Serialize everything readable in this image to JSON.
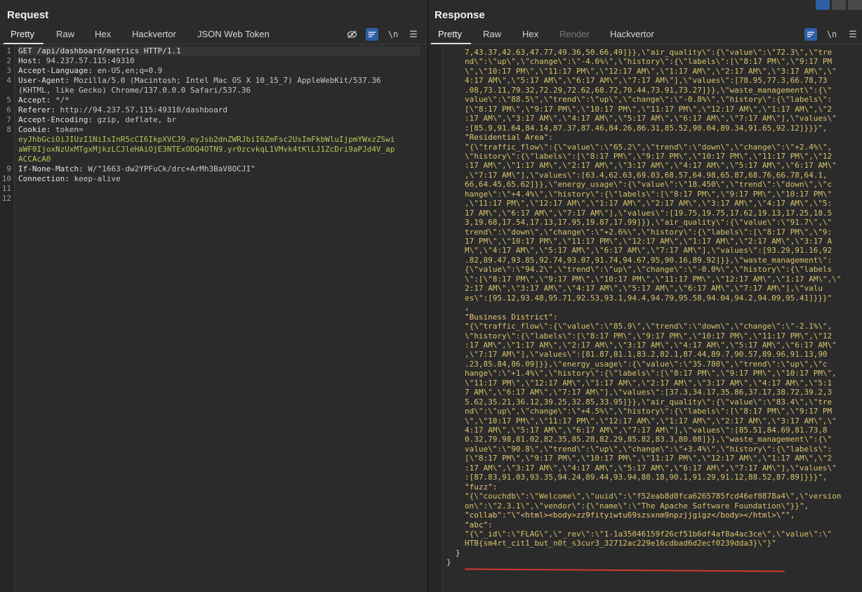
{
  "request": {
    "title": "Request",
    "tabs": [
      "Pretty",
      "Raw",
      "Hex",
      "Hackvertor",
      "JSON Web Token"
    ],
    "lines": [
      {
        "n": "1",
        "key": "GET /api/dashboard/metrics HTTP/1.1",
        "val": ""
      },
      {
        "n": "2",
        "key": "Host: ",
        "val": "94.237.57.115:49310"
      },
      {
        "n": "3",
        "key": "Accept-Language: ",
        "val": "en-US,en;q=0.9"
      },
      {
        "n": "4",
        "key": "User-Agent: ",
        "val": "Mozilla/5.0 (Macintosh; Intel Mac OS X 10_15_7) AppleWebKit/537.36"
      },
      {
        "n": "",
        "key": "",
        "val": "(KHTML, like Gecko) Chrome/137.0.0.0 Safari/537.36"
      },
      {
        "n": "5",
        "key": "Accept: ",
        "val": "*/*"
      },
      {
        "n": "6",
        "key": "Referer: ",
        "val": "http://94.237.57.115:49310/dashboard"
      },
      {
        "n": "7",
        "key": "Accept-Encoding: ",
        "val": "gzip, deflate, br"
      },
      {
        "n": "8",
        "key": "Cookie: ",
        "val": "token="
      },
      {
        "n": "",
        "key": "",
        "tok": "eyJhbGciOiJIUzI1NiIsInR5cCI6IkpXVCJ9.eyJsb2dnZWRJbiI6ZmFsc2UsImFkbWluIjpmYWxzZSwi"
      },
      {
        "n": "",
        "key": "",
        "tok": "aWF0IjoxNzUxMTgxMjkzLCJleHAiOjE3NTExODQ4OTN9.yr0zcvkqL1VMvk4tKlLJ1ZcDri9aPJd4V_ap"
      },
      {
        "n": "",
        "key": "",
        "tok": "ACCAcA0"
      },
      {
        "n": "9",
        "key": "If-None-Match: ",
        "val": "W/\"1663-dw2YPFuCk/drc+ArMh3BaV8OCJI\""
      },
      {
        "n": "10",
        "key": "Connection: ",
        "val": "keep-alive"
      },
      {
        "n": "11",
        "key": "",
        "val": ""
      },
      {
        "n": "12",
        "key": "",
        "val": ""
      }
    ]
  },
  "response": {
    "title": "Response",
    "tabs": [
      "Pretty",
      "Raw",
      "Hex",
      "Render",
      "Hackvertor"
    ],
    "lines": [
      {
        "t": "str",
        "text": "7,43.37,42.63,47.77,49.36,50.66,49]}},\\\"air_quality\\\":{\\\"value\\\":\\\"72.3\\\",\\\"tre"
      },
      {
        "t": "str",
        "text": "nd\\\":\\\"up\\\",\\\"change\\\":\\\"-4.6%\\\",\\\"history\\\":{\\\"labels\\\":[\\\"8:17 PM\\\",\\\"9:17 PM"
      },
      {
        "t": "str",
        "text": "\\\",\\\"10:17 PM\\\",\\\"11:17 PM\\\",\\\"12:17 AM\\\",\\\"1:17 AM\\\",\\\"2:17 AM\\\",\\\"3:17 AM\\\",\\\""
      },
      {
        "t": "str",
        "text": "4:17 AM\\\",\\\"5:17 AM\\\",\\\"6:17 AM\\\",\\\"7:17 AM\\\"],\\\"values\\\":[78.95,77.3,66.78,73"
      },
      {
        "t": "str",
        "text": ".08,73.11,79.32,72.29,72.62,68.72,70.44,73.91,73.27]}},\\\"waste_management\\\":{\\\""
      },
      {
        "t": "str",
        "text": "value\\\":\\\"88.5\\\",\\\"trend\\\":\\\"up\\\",\\\"change\\\":\\\"-0.8%\\\",\\\"history\\\":{\\\"labels\\\":"
      },
      {
        "t": "str",
        "text": "[\\\"8:17 PM\\\",\\\"9:17 PM\\\",\\\"10:17 PM\\\",\\\"11:17 PM\\\",\\\"12:17 AM\\\",\\\"1:17 AM\\\",\\\"2"
      },
      {
        "t": "str",
        "text": ":17 AM\\\",\\\"3:17 AM\\\",\\\"4:17 AM\\\",\\\"5:17 AM\\\",\\\"6:17 AM\\\",\\\"7:17 AM\\\"],\\\"values\\\""
      },
      {
        "t": "str",
        "text": ":[85.9,91.64,84.14,87.37,87.46,84.26,86.31,85.52,90.04,89.34,91.65,92.12]}}}\","
      },
      {
        "t": "key",
        "text": "\"Residential Area\":"
      },
      {
        "t": "str",
        "text": "\"{\\\"traffic_flow\\\":{\\\"value\\\":\\\"65.2\\\",\\\"trend\\\":\\\"down\\\",\\\"change\\\":\\\"+2.4%\\\","
      },
      {
        "t": "str",
        "text": "\\\"history\\\":{\\\"labels\\\":[\\\"8:17 PM\\\",\\\"9:17 PM\\\",\\\"10:17 PM\\\",\\\"11:17 PM\\\",\\\"12"
      },
      {
        "t": "str",
        "text": ":17 AM\\\",\\\"1:17 AM\\\",\\\"2:17 AM\\\",\\\"3:17 AM\\\",\\\"4:17 AM\\\",\\\"5:17 AM\\\",\\\"6:17 AM\\\""
      },
      {
        "t": "str",
        "text": ",\\\"7:17 AM\\\"],\\\"values\\\":[63.4,62.63,69.03,68.57,64.98,65.87,68.76,66.78,64.1,"
      },
      {
        "t": "str",
        "text": "66,64.45,65.62]}},\\\"energy_usage\\\":{\\\"value\\\":\\\"18.450\\\",\\\"trend\\\":\\\"down\\\",\\\"c"
      },
      {
        "t": "str",
        "text": "hange\\\":\\\"+4.4%\\\",\\\"history\\\":{\\\"labels\\\":[\\\"8:17 PM\\\",\\\"9:17 PM\\\",\\\"10:17 PM\\\""
      },
      {
        "t": "str",
        "text": ",\\\"11:17 PM\\\",\\\"12:17 AM\\\",\\\"1:17 AM\\\",\\\"2:17 AM\\\",\\\"3:17 AM\\\",\\\"4:17 AM\\\",\\\"5:"
      },
      {
        "t": "str",
        "text": "17 AM\\\",\\\"6:17 AM\\\",\\\"7:17 AM\\\"],\\\"values\\\":[19.75,19.75,17.62,19.13,17.25,18.5"
      },
      {
        "t": "str",
        "text": "3,19.68,17.54,17.13,17.95,19.87,17.99]}},\\\"air_quality\\\":{\\\"value\\\":\\\"91.7\\\",\\\""
      },
      {
        "t": "str",
        "text": "trend\\\":\\\"down\\\",\\\"change\\\":\\\"+2.6%\\\",\\\"history\\\":{\\\"labels\\\":[\\\"8:17 PM\\\",\\\"9:"
      },
      {
        "t": "str",
        "text": "17 PM\\\",\\\"10:17 PM\\\",\\\"11:17 PM\\\",\\\"12:17 AM\\\",\\\"1:17 AM\\\",\\\"2:17 AM\\\",\\\"3:17 A"
      },
      {
        "t": "str",
        "text": "M\\\",\\\"4:17 AM\\\",\\\"5:17 AM\\\",\\\"6:17 AM\\\",\\\"7:17 AM\\\"],\\\"values\\\":[93.29,91.16,92"
      },
      {
        "t": "str",
        "text": ".82,89.47,93.85,92.74,93.07,91.74,94.67,95,90.16,89.92]}},\\\"waste_management\\\":"
      },
      {
        "t": "str",
        "text": "{\\\"value\\\":\\\"94.2\\\",\\\"trend\\\":\\\"up\\\",\\\"change\\\":\\\"-0.0%\\\",\\\"history\\\":{\\\"labels"
      },
      {
        "t": "str",
        "text": "\\\":[\\\"8:17 PM\\\",\\\"9:17 PM\\\",\\\"10:17 PM\\\",\\\"11:17 PM\\\",\\\"12:17 AM\\\",\\\"1:17 AM\\\",\\\""
      },
      {
        "t": "str",
        "text": "2:17 AM\\\",\\\"3:17 AM\\\",\\\"4:17 AM\\\",\\\"5:17 AM\\\",\\\"6:17 AM\\\",\\\"7:17 AM\\\"],\\\"valu"
      },
      {
        "t": "str",
        "text": "es\\\":[95.12,93.48,95.71,92.53,93.1,94.4,94.79,95.58,94.04,94.2,94.09,95.41]}}}\""
      },
      {
        "t": "brace",
        "text": ","
      },
      {
        "t": "key",
        "text": "\"Business District\":"
      },
      {
        "t": "str",
        "text": "\"{\\\"traffic_flow\\\":{\\\"value\\\":\\\"85.9\\\",\\\"trend\\\":\\\"down\\\",\\\"change\\\":\\\"-2.1%\\\","
      },
      {
        "t": "str",
        "text": "\\\"history\\\":{\\\"labels\\\":[\\\"8:17 PM\\\",\\\"9:17 PM\\\",\\\"10:17 PM\\\",\\\"11:17 PM\\\",\\\"12"
      },
      {
        "t": "str",
        "text": ":17 AM\\\",\\\"1:17 AM\\\",\\\"2:17 AM\\\",\\\"3:17 AM\\\",\\\"4:17 AM\\\",\\\"5:17 AM\\\",\\\"6:17 AM\\\""
      },
      {
        "t": "str",
        "text": ",\\\"7:17 AM\\\"],\\\"values\\\":[81.87,81.1,83.2,82.1,87.44,89.7,90.57,89.96,91.13,90"
      },
      {
        "t": "str",
        "text": ".23,85.84,86.09]}},\\\"energy_usage\\\":{\\\"value\\\":\\\"35.780\\\",\\\"trend\\\":\\\"up\\\",\\\"c"
      },
      {
        "t": "str",
        "text": "hange\\\":\\\"+1.4%\\\",\\\"history\\\":{\\\"labels\\\":[\\\"8:17 PM\\\",\\\"9:17 PM\\\",\\\"10:17 PM\\\","
      },
      {
        "t": "str",
        "text": "\\\"11:17 PM\\\",\\\"12:17 AM\\\",\\\"1:17 AM\\\",\\\"2:17 AM\\\",\\\"3:17 AM\\\",\\\"4:17 AM\\\",\\\"5:1"
      },
      {
        "t": "str",
        "text": "7 AM\\\",\\\"6:17 AM\\\",\\\"7:17 AM\\\"],\\\"values\\\":[37.3,34.17,35.86,37.17,38.72,39.2,3"
      },
      {
        "t": "str",
        "text": "5.62,35.21,36.12,39.25,32.85,33.95]}},\\\"air_quality\\\":{\\\"value\\\":\\\"83.4\\\",\\\"tre"
      },
      {
        "t": "str",
        "text": "nd\\\":\\\"up\\\",\\\"change\\\":\\\"+4.5%\\\",\\\"history\\\":{\\\"labels\\\":[\\\"8:17 PM\\\",\\\"9:17 PM"
      },
      {
        "t": "str",
        "text": "\\\",\\\"10:17 PM\\\",\\\"11:17 PM\\\",\\\"12:17 AM\\\",\\\"1:17 AM\\\",\\\"2:17 AM\\\",\\\"3:17 AM\\\",\\\""
      },
      {
        "t": "str",
        "text": "4:17 AM\\\",\\\"5:17 AM\\\",\\\"6:17 AM\\\",\\\"7:17 AM\\\"],\\\"values\\\":[85.51,84.69,81.73,8"
      },
      {
        "t": "str",
        "text": "0.32,79.98,81.02,82.35,85.28,82.29,85.82,83.3,80.08]}},\\\"waste_management\\\":{\\\""
      },
      {
        "t": "str",
        "text": "value\\\":\\\"90.8\\\",\\\"trend\\\":\\\"up\\\",\\\"change\\\":\\\"+3.4%\\\",\\\"history\\\":{\\\"labels\\\":"
      },
      {
        "t": "str",
        "text": "[\\\"8:17 PM\\\",\\\"9:17 PM\\\",\\\"10:17 PM\\\",\\\"11:17 PM\\\",\\\"12:17 AM\\\",\\\"1:17 AM\\\",\\\"2"
      },
      {
        "t": "str",
        "text": ":17 AM\\\",\\\"3:17 AM\\\",\\\"4:17 AM\\\",\\\"5:17 AM\\\",\\\"6:17 AM\\\",\\\"7:17 AM\\\"],\\\"values\\\""
      },
      {
        "t": "str",
        "text": ":[87.83,91.03,93.35,94.24,89.44,93.94,88.18,90.1,91.29,91.12,88.52,87.89]}}}\","
      },
      {
        "t": "key",
        "text": "\"fuzz\":"
      },
      {
        "t": "str",
        "text": "\"{\\\"couchdb\\\":\\\"Welcome\\\",\\\"uuid\\\":\\\"f52eab8d0fca6265785fcd46ef0878a4\\\",\\\"version"
      },
      {
        "t": "str",
        "text": "on\\\":\\\"2.3.1\\\",\\\"vendor\\\":{\\\"name\\\":\\\"The Apache Software Foundation\\\"}}\","
      },
      {
        "t": "key",
        "text": "\"collab\":\"\\\"<html><body>zz9fityiwtu69szsxnm9npzjjgigz</body></html>\\\"\","
      },
      {
        "t": "key",
        "text": "\"abc\":"
      },
      {
        "t": "str",
        "text": "\"{\\\"_id\\\":\\\"FLAG\\\",\\\"_rev\\\":\\\"1-1a35046159f26cf51b6df4af8a4ac3ce\\\",\\\"value\\\":\\\""
      },
      {
        "t": "str",
        "text": "HTB{sm4rt_cit1_but_n0t_s3cur3_32712ac229e16cdbad6d2ecf0239dda3}\\\"}\""
      },
      {
        "t": "brace",
        "text": "}"
      },
      {
        "t": "brace",
        "text": "}"
      }
    ]
  }
}
